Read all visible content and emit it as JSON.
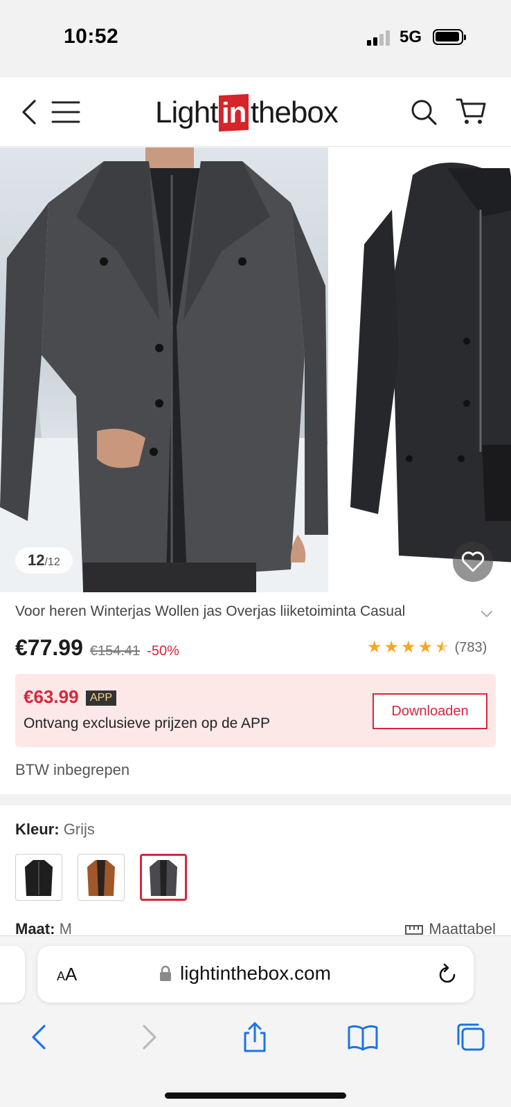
{
  "status_bar": {
    "time": "10:52",
    "network": "5G"
  },
  "header": {
    "logo_left": "Light",
    "logo_in": "in",
    "logo_right": "thebox"
  },
  "gallery": {
    "counter_current": "12",
    "counter_total": "/12"
  },
  "product": {
    "title": "Voor heren Winterjas Wollen jas Overjas liiketoiminta Casual",
    "price": "€77.99",
    "old_price": "€154.41",
    "discount": "-50%",
    "rating_stars": 4.5,
    "review_count": "(783)",
    "vat_note": "BTW inbegrepen"
  },
  "app_promo": {
    "price": "€63.99",
    "badge": "APP",
    "text": "Ontvang exclusieve prijzen op de APP",
    "button": "Downloaden"
  },
  "options": {
    "color_label": "Kleur:",
    "color_value": "Grijs",
    "swatches": [
      {
        "name": "black",
        "color": "#1e1e1e"
      },
      {
        "name": "brown",
        "color": "#a0582a"
      },
      {
        "name": "grey",
        "color": "#4a4a4e",
        "selected": true
      }
    ],
    "size_label": "Maat:",
    "size_value": "M",
    "size_chart": "Maattabel"
  },
  "browser": {
    "aa_label_small": "A",
    "aa_label_big": "A",
    "url": "lightinthebox.com"
  },
  "colors": {
    "accent_red": "#d7263d",
    "promo_bg": "#fde8e8",
    "star": "#f5a623",
    "ios_blue": "#1a73e8"
  }
}
